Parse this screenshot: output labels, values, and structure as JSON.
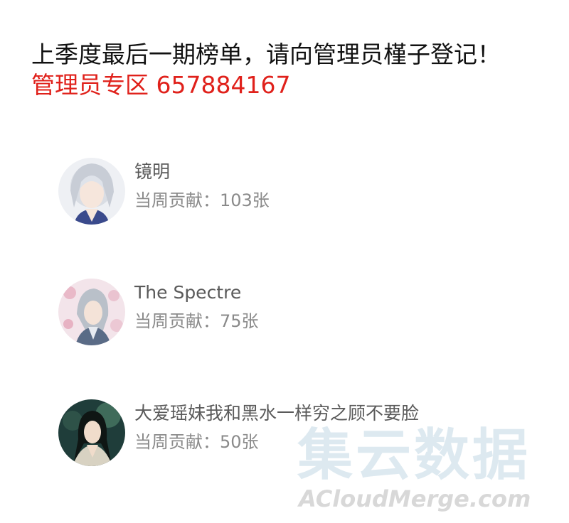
{
  "header": {
    "announcement": "上季度最后一期榜单，请向管理员槿子登记！",
    "admin_zone": "管理员专区 657884167"
  },
  "ranking": [
    {
      "name": "镜明",
      "contribution": "当周贡献：103张",
      "avatar": "white-haired-character-avatar"
    },
    {
      "name": "The Spectre",
      "contribution": "当周贡献：75张",
      "avatar": "blossom-character-avatar"
    },
    {
      "name": "大爱瑶妹我和黑水一样穷之顾不要脸",
      "contribution": "当周贡献：50张",
      "avatar": "dark-haired-character-avatar"
    }
  ],
  "watermark": {
    "title": "集云数据",
    "subtitle": "ACloudMerge.com"
  }
}
